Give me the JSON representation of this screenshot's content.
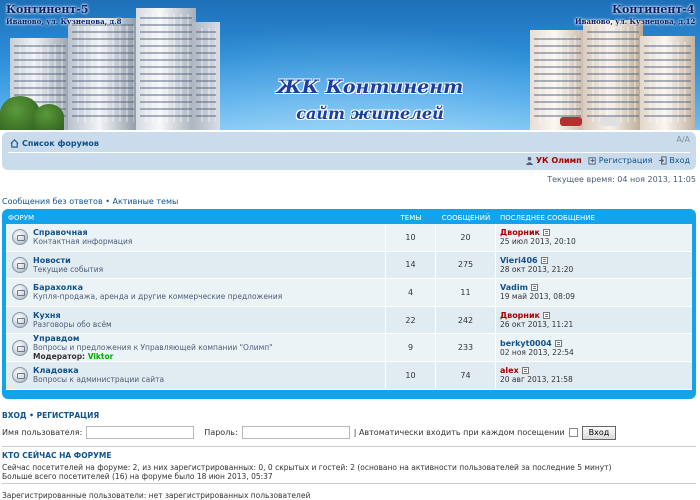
{
  "banner": {
    "left_title": "Континент-5",
    "left_address": "Иваново, ул. Кузнецова, д.8",
    "right_title": "Континент-4",
    "right_address": "Иваново, ул. Кузнецова, д.12",
    "site_title": "ЖК Континент",
    "site_subtitle": "сайт жителей"
  },
  "nav": {
    "breadcrumb_label": "Список форумов",
    "breadcrumb_icon": "home-icon",
    "font_size_control": "A/A",
    "username": "УК Олимп",
    "register_label": "Регистрация",
    "login_label": "Вход"
  },
  "current_time": "Текущее время: 04 ноя 2013, 11:05",
  "quick_links": "Сообщения без ответов • Активные темы",
  "forum_table": {
    "header": {
      "forum": "Форум",
      "topics": "Темы",
      "posts": "Сообщений",
      "last_post": "Последнее сообщение"
    },
    "rows": [
      {
        "title": "Справочная",
        "description": "Контактная информация",
        "moderator_label": "",
        "moderator": "",
        "topics": "10",
        "posts": "20",
        "last_author": "Дворник",
        "last_author_color": "#aa0000",
        "last_date": "25 июл 2013, 20:10"
      },
      {
        "title": "Новости",
        "description": "Текущие события",
        "moderator_label": "",
        "moderator": "",
        "topics": "14",
        "posts": "275",
        "last_author": "Vieri406",
        "last_author_color": "#105289",
        "last_date": "28 окт 2013, 21:20"
      },
      {
        "title": "Барахолка",
        "description": "Купля-продажа, аренда и другие коммерческие предложения",
        "moderator_label": "",
        "moderator": "",
        "topics": "4",
        "posts": "11",
        "last_author": "Vadim",
        "last_author_color": "#105289",
        "last_date": "19 май 2013, 08:09"
      },
      {
        "title": "Кухня",
        "description": "Разговоры обо всём",
        "moderator_label": "",
        "moderator": "",
        "topics": "22",
        "posts": "242",
        "last_author": "Дворник",
        "last_author_color": "#aa0000",
        "last_date": "26 окт 2013, 11:21"
      },
      {
        "title": "Управдом",
        "description": "Вопросы и предложения к Управляющей компании \"Олимп\"",
        "moderator_label": "Модератор:",
        "moderator": "Viktor",
        "topics": "9",
        "posts": "233",
        "last_author": "berkyt0004",
        "last_author_color": "#105289",
        "last_date": "02 ноя 2013, 22:54"
      },
      {
        "title": "Кладовка",
        "description": "Вопросы к администрации сайта",
        "moderator_label": "",
        "moderator": "",
        "topics": "10",
        "posts": "74",
        "last_author": "alex",
        "last_author_color": "#aa0000",
        "last_date": "20 авг 2013, 21:58"
      }
    ]
  },
  "login": {
    "heading": "Вход • Регистрация",
    "username_label": "Имя пользователя:",
    "username_value": "",
    "password_label": "Пароль:",
    "password_value": "",
    "auto_login_label": "| Автоматически входить при каждом посещении",
    "submit_label": "Вход"
  },
  "online": {
    "heading": "Кто сейчас на форуме",
    "line1": "Сейчас посетителей на форуме: 2, из них зарегистрированных: 0, 0 скрытых и гостей: 2 (основано на активности пользователей за последние 5 минут)",
    "line2": "Больше всего посетителей (16) на форуме было 18 июн 2013, 05:37",
    "registered": "Зарегистрированные пользователи: нет зарегистрированных пользователей"
  },
  "colors": {
    "accent": "#12a3eb",
    "link": "#105289",
    "admin": "#aa0000",
    "moderator": "#00aa00",
    "navbar_bg": "#cadceb"
  }
}
